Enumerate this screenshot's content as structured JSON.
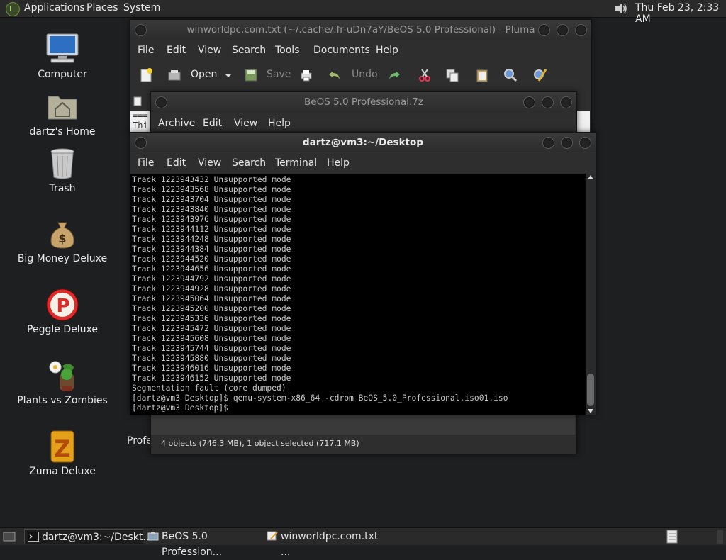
{
  "top_panel": {
    "menus": [
      "Applications",
      "Places",
      "System"
    ],
    "clock": "Thu Feb 23,  2:33 AM",
    "icons": [
      "mate-menu-icon",
      "volume-icon"
    ]
  },
  "desktop": {
    "icons": [
      {
        "label": "Computer",
        "icon": "computer-icon"
      },
      {
        "label": "dartz's Home",
        "icon": "home-folder-icon"
      },
      {
        "label": "Trash",
        "icon": "trash-icon"
      },
      {
        "label": "Big Money Deluxe",
        "icon": "money-bag-icon"
      },
      {
        "label": "Peggle Deluxe",
        "icon": "peggle-icon"
      },
      {
        "label": "Plants vs Zombies",
        "icon": "plants-vs-zombies-icon"
      },
      {
        "label": "Zuma Deluxe",
        "icon": "zuma-icon"
      }
    ],
    "partial_label": "Profe"
  },
  "pluma": {
    "title": "winworldpc.com.txt (~/.cache/.fr-uDn7aY/BeOS 5.0 Professional) - Pluma",
    "menus": [
      "File",
      "Edit",
      "View",
      "Search",
      "Tools",
      "Documents",
      "Help"
    ],
    "toolbar": {
      "open": "Open",
      "save": "Save",
      "undo": "Undo"
    },
    "text_fragment": [
      "===",
      "Thi"
    ]
  },
  "archive": {
    "title": "BeOS 5.0 Professional.7z",
    "menus": [
      "Archive",
      "Edit",
      "View",
      "Help"
    ],
    "status": "4 objects (746.3 MB), 1 object selected (717.1 MB)"
  },
  "terminal": {
    "title": "dartz@vm3:~/Desktop",
    "menus": [
      "File",
      "Edit",
      "View",
      "Search",
      "Terminal",
      "Help"
    ],
    "lines": [
      "Track 1223943432 Unsupported mode",
      "Track 1223943568 Unsupported mode",
      "Track 1223943704 Unsupported mode",
      "Track 1223943840 Unsupported mode",
      "Track 1223943976 Unsupported mode",
      "Track 1223944112 Unsupported mode",
      "Track 1223944248 Unsupported mode",
      "Track 1223944384 Unsupported mode",
      "Track 1223944520 Unsupported mode",
      "Track 1223944656 Unsupported mode",
      "Track 1223944792 Unsupported mode",
      "Track 1223944928 Unsupported mode",
      "Track 1223945064 Unsupported mode",
      "Track 1223945200 Unsupported mode",
      "Track 1223945336 Unsupported mode",
      "Track 1223945472 Unsupported mode",
      "Track 1223945608 Unsupported mode",
      "Track 1223945744 Unsupported mode",
      "Track 1223945880 Unsupported mode",
      "Track 1223946016 Unsupported mode",
      "Track 1223946152 Unsupported mode",
      "Segmentation fault (core dumped)",
      "[dartz@vm3 Desktop]$ qemu-system-x86_64 -cdrom BeOS_5.0_Professional.iso01.iso",
      "[dartz@vm3 Desktop]$"
    ]
  },
  "taskbar": {
    "tasks": [
      {
        "label": "dartz@vm3:~/Deskt...",
        "icon": "terminal-icon"
      },
      {
        "label": "BeOS 5.0 Profession...",
        "icon": "archive-icon"
      },
      {
        "label": "winworldpc.com.txt ...",
        "icon": "text-editor-icon"
      }
    ]
  },
  "colors": {
    "desktop": "#1d1f21",
    "panel": "#2a2a2a",
    "terminal_bg": "#000000",
    "terminal_fg": "#c8c8c8"
  }
}
